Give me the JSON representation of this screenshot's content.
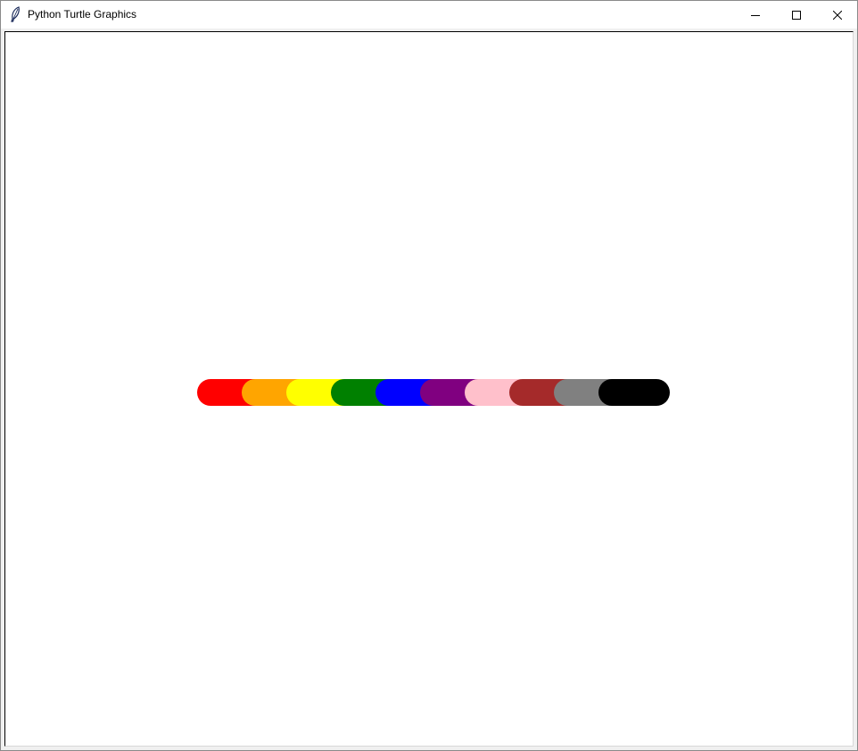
{
  "window": {
    "title": "Python Turtle Graphics"
  },
  "icons": {
    "app": "feather-icon",
    "minimize": "minimize-icon",
    "maximize": "maximize-icon",
    "close": "close-icon"
  },
  "drawing": {
    "segment_colors": [
      "#ff0000",
      "#ffa500",
      "#ffff00",
      "#008000",
      "#0000ff",
      "#800080",
      "#ffc0cb",
      "#a52a2a",
      "#808080",
      "#000000"
    ]
  }
}
